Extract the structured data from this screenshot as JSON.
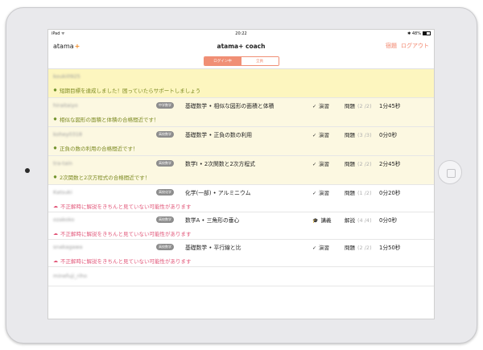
{
  "status": {
    "left": "iPad ᯤ",
    "time": "20:22",
    "right": "✱ 48%"
  },
  "header": {
    "logo": "atama",
    "logo_plus": "+",
    "title": "atama+ coach",
    "links": [
      "宿題",
      "ログアウト"
    ]
  },
  "segment": {
    "active": "ログイン中",
    "inactive": "全員"
  },
  "goal_row": {
    "user": "kouki0925",
    "note": "短期目標を達成しました！困っていたらサポートしましょう"
  },
  "rows": [
    {
      "user": "hiraitaiyo",
      "badge": "中学数学",
      "subject": "基礎数学 • 相似な図形の面積と体積",
      "activity_icon": "✓",
      "activity": "演習",
      "kind": "問題",
      "count": "(2 /2)",
      "time": "1分45秒",
      "note": "相似な図形の面積と体積の合格間近です！",
      "type": "pass"
    },
    {
      "user": "kohey0318",
      "badge": "高校数学",
      "subject": "基礎数学 • 正負の数の利用",
      "activity_icon": "✓",
      "activity": "演習",
      "kind": "問題",
      "count": "(3 /3)",
      "time": "0分0秒",
      "note": "正負の数の利用の合格間近です！",
      "type": "pass"
    },
    {
      "user": "tra-tain",
      "badge": "高校数学",
      "subject": "数学I • 2次関数と2次方程式",
      "activity_icon": "✓",
      "activity": "演習",
      "kind": "問題",
      "count": "(2 /2)",
      "time": "2分45秒",
      "note": "2次関数と2次方程式の合格間近です！",
      "type": "pass"
    },
    {
      "user": "Katsuki",
      "badge": "高校化学",
      "subject": "化学(一部) • アルミニウム",
      "activity_icon": "✓",
      "activity": "演習",
      "kind": "問題",
      "count": "(1 /2)",
      "time": "0分20秒",
      "note": "不正解時に解説をきちんと見ていない可能性があります",
      "type": "warn"
    },
    {
      "user": "ozakoko",
      "badge": "高校数学",
      "subject": "数学A • 三角形の垂心",
      "activity_icon": "🎓",
      "activity": "講義",
      "kind": "解説",
      "count": "(4 /4)",
      "time": "0分0秒",
      "note": "不正解時に解説をきちんと見ていない可能性があります",
      "type": "warn"
    },
    {
      "user": "snakagawa",
      "badge": "高校数学",
      "subject": "基礎数学 • 平行線と比",
      "activity_icon": "✓",
      "activity": "演習",
      "kind": "問題",
      "count": "(2 /2)",
      "time": "1分50秒",
      "note": "不正解時に解説をきちんと見ていない可能性があります",
      "type": "warn"
    }
  ],
  "last_row": {
    "user": "minefuji_riho"
  },
  "colors": {
    "accent": "#f08a24",
    "link": "#f2846b",
    "goal_bg": "#fdf6bf",
    "pass_bg": "#fcf8e1",
    "warn_text": "#e2587a"
  }
}
